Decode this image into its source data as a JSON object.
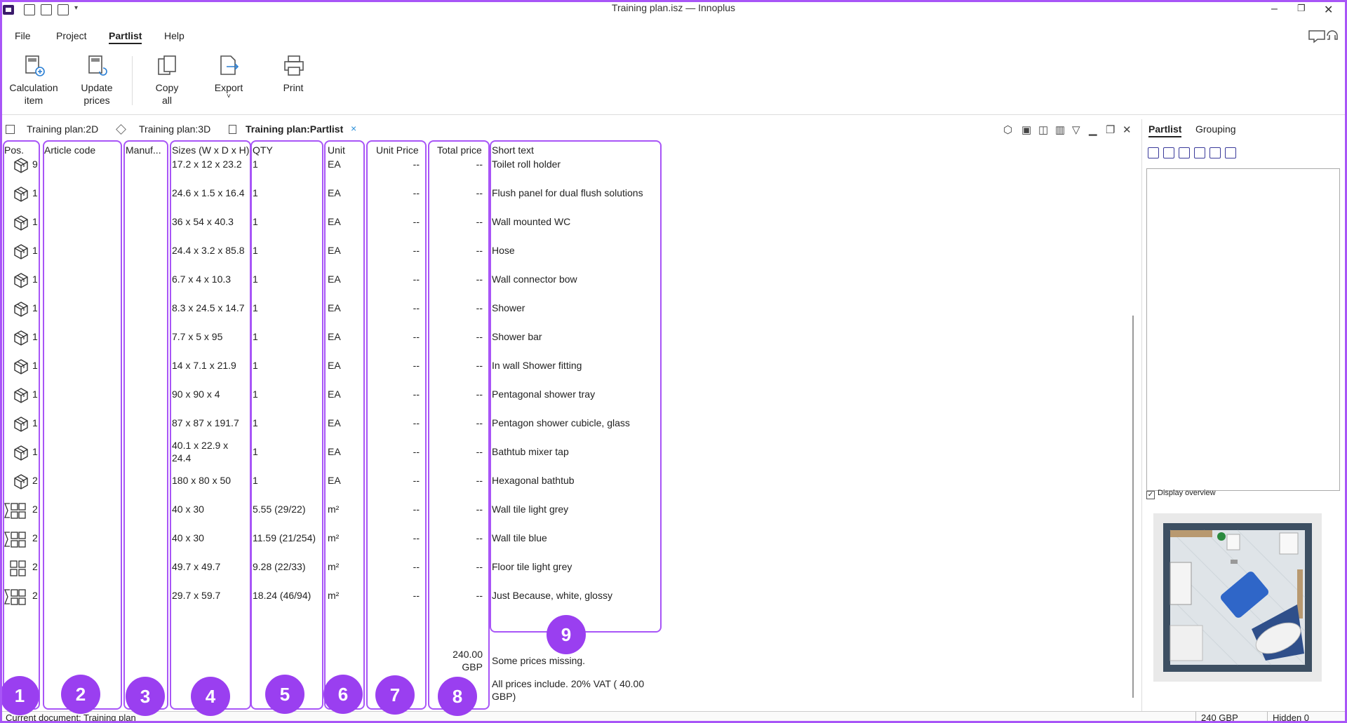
{
  "window": {
    "title": "Training plan.isz — Innoplus",
    "minimize_glyph": "‒",
    "restore_glyph": "❐",
    "close_glyph": "✕"
  },
  "menu": {
    "items": [
      {
        "label": "File"
      },
      {
        "label": "Project"
      },
      {
        "label": "Partlist",
        "active": true
      },
      {
        "label": "Help"
      }
    ]
  },
  "ribbon": {
    "calc_line1": "Calculation",
    "calc_line2": "item",
    "update_line1": "Update",
    "update_line2": "prices",
    "copy_line1": "Copy",
    "copy_line2": "all",
    "export_label": "Export",
    "export_chevron": "˅",
    "print_label": "Print"
  },
  "tabs": {
    "items": [
      {
        "label": "Training plan:2D"
      },
      {
        "label": "Training plan:3D"
      },
      {
        "label": "Training plan:Partlist",
        "active": true
      }
    ],
    "close_glyph": "×"
  },
  "table": {
    "headers": {
      "pos": "Pos.",
      "article": "Article code",
      "manuf": "Manuf...",
      "sizes": "Sizes (W x D x H)",
      "qty": "QTY",
      "unit": "Unit",
      "unit_price": "Unit Price",
      "total_price": "Total price",
      "short_text": "Short text"
    },
    "rows": [
      {
        "icon": "box-icon",
        "pos": "9",
        "sizes": "17.2 x 12 x 23.2",
        "qty": "1",
        "unit": "EA",
        "unit_price": "--",
        "total": "--",
        "text": "Toilet roll holder"
      },
      {
        "icon": "box-icon",
        "pos": "1",
        "sizes": "24.6 x 1.5 x 16.4",
        "qty": "1",
        "unit": "EA",
        "unit_price": "--",
        "total": "--",
        "text": "Flush panel for dual flush solutions"
      },
      {
        "icon": "box-icon",
        "pos": "1",
        "sizes": "36 x 54 x 40.3",
        "qty": "1",
        "unit": "EA",
        "unit_price": "--",
        "total": "--",
        "text": "Wall mounted WC"
      },
      {
        "icon": "box-icon",
        "pos": "1",
        "sizes": "24.4 x 3.2 x 85.8",
        "qty": "1",
        "unit": "EA",
        "unit_price": "--",
        "total": "--",
        "text": "Hose"
      },
      {
        "icon": "box-icon",
        "pos": "1",
        "sizes": "6.7 x 4 x 10.3",
        "qty": "1",
        "unit": "EA",
        "unit_price": "--",
        "total": "--",
        "text": "Wall connector bow"
      },
      {
        "icon": "box-icon",
        "pos": "1",
        "sizes": "8.3 x 24.5 x 14.7",
        "qty": "1",
        "unit": "EA",
        "unit_price": "--",
        "total": "--",
        "text": "Shower"
      },
      {
        "icon": "box-icon",
        "pos": "1",
        "sizes": "7.7 x 5 x 95",
        "qty": "1",
        "unit": "EA",
        "unit_price": "--",
        "total": "--",
        "text": "Shower bar"
      },
      {
        "icon": "box-icon",
        "pos": "1",
        "sizes": "14 x 7.1 x 21.9",
        "qty": "1",
        "unit": "EA",
        "unit_price": "--",
        "total": "--",
        "text": "In wall Shower fitting"
      },
      {
        "icon": "box-icon",
        "pos": "1",
        "sizes": "90 x 90 x 4",
        "qty": "1",
        "unit": "EA",
        "unit_price": "--",
        "total": "--",
        "text": "Pentagonal shower tray"
      },
      {
        "icon": "box-icon",
        "pos": "1",
        "sizes": "87 x 87 x 191.7",
        "qty": "1",
        "unit": "EA",
        "unit_price": "--",
        "total": "--",
        "text": "Pentagon shower cubicle, glass"
      },
      {
        "icon": "box-icon",
        "pos": "1",
        "sizes1": "40.1 x 22.9 x",
        "sizes2": "24.4",
        "qty": "1",
        "unit": "EA",
        "unit_price": "--",
        "total": "--",
        "text": "Bathtub mixer tap"
      },
      {
        "icon": "box-icon",
        "pos": "2",
        "sizes": "180 x 80 x 50",
        "qty": "1",
        "unit": "EA",
        "unit_price": "--",
        "total": "--",
        "text": "Hexagonal bathtub"
      },
      {
        "icon": "sum-tile-icon",
        "pos": "2",
        "sizes": "40 x 30",
        "qty": "5.55 (29/22)",
        "unit": "m²",
        "unit_price": "--",
        "total": "--",
        "text": "Wall tile light grey"
      },
      {
        "icon": "sum-tile-icon",
        "pos": "2",
        "sizes": "40 x 30",
        "qty": "11.59 (21/254)",
        "unit": "m²",
        "unit_price": "--",
        "total": "--",
        "text": "Wall tile blue"
      },
      {
        "icon": "tile-icon",
        "pos": "2",
        "sizes": "49.7 x 49.7",
        "qty": "9.28 (22/33)",
        "unit": "m²",
        "unit_price": "--",
        "total": "--",
        "text": "Floor tile light grey"
      },
      {
        "icon": "sum-tile-icon",
        "pos": "2",
        "sizes": "29.7 x 59.7",
        "qty": "18.24 (46/94)",
        "unit": "m²",
        "unit_price": "--",
        "total": "--",
        "text": "Just Because, white, glossy"
      }
    ],
    "summary": {
      "total_line1": "240.00",
      "total_line2": "GBP",
      "missing_note": "Some prices missing.",
      "vat_line1": "All prices include. 20% VAT (   40.00",
      "vat_line2": "GBP)"
    }
  },
  "annotations": {
    "badges": [
      "1",
      "2",
      "3",
      "4",
      "5",
      "6",
      "7",
      "8",
      "9"
    ],
    "color": "#9a3ff0"
  },
  "right_panel": {
    "tabs": [
      {
        "label": "Partlist",
        "active": true
      },
      {
        "label": "Grouping"
      }
    ],
    "display_overview_label": "Display overview",
    "checkbox_mark": "✓"
  },
  "status": {
    "document": "Current document: Training plan",
    "total": "240  GBP",
    "hidden": "Hidden 0"
  }
}
